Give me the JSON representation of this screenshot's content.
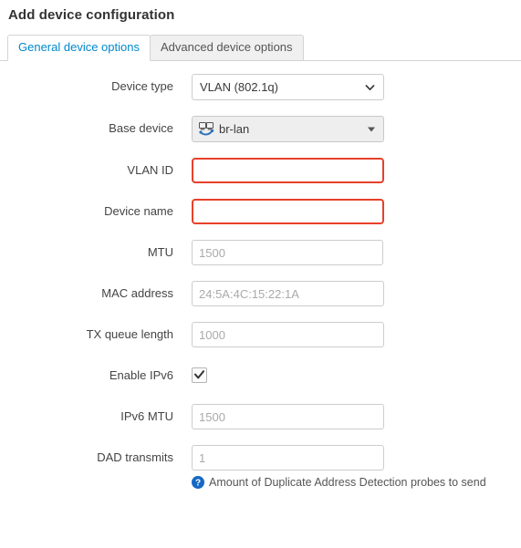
{
  "page": {
    "title": "Add device configuration"
  },
  "tabs": [
    {
      "label": "General device options",
      "active": true
    },
    {
      "label": "Advanced device options",
      "active": false
    }
  ],
  "form": {
    "device_type": {
      "label": "Device type",
      "value": "VLAN (802.1q)",
      "options": [
        "VLAN (802.1q)"
      ],
      "icon": "chevron-down-icon"
    },
    "base_device": {
      "label": "Base device",
      "value": "br-lan",
      "icon": "bridge-device-icon",
      "caret": "caret-down-icon"
    },
    "vlan_id": {
      "label": "VLAN ID",
      "value": "",
      "placeholder": "",
      "invalid": true
    },
    "device_name": {
      "label": "Device name",
      "value": "",
      "placeholder": "",
      "invalid": true
    },
    "mtu": {
      "label": "MTU",
      "value": "",
      "placeholder": "1500"
    },
    "mac_address": {
      "label": "MAC address",
      "value": "",
      "placeholder": "24:5A:4C:15:22:1A"
    },
    "tx_queue_length": {
      "label": "TX queue length",
      "value": "",
      "placeholder": "1000"
    },
    "enable_ipv6": {
      "label": "Enable IPv6",
      "checked": true,
      "icon": "checkmark-icon"
    },
    "ipv6_mtu": {
      "label": "IPv6 MTU",
      "value": "",
      "placeholder": "1500"
    },
    "dad_transmits": {
      "label": "DAD transmits",
      "value": "",
      "placeholder": "1",
      "help": "Amount of Duplicate Address Detection probes to send",
      "help_icon": "help-circle-icon"
    }
  },
  "colors": {
    "accent": "#0088cc",
    "error": "#e8402a",
    "help_icon": "#1668c4",
    "text": "#404040",
    "border": "#cccccc"
  }
}
